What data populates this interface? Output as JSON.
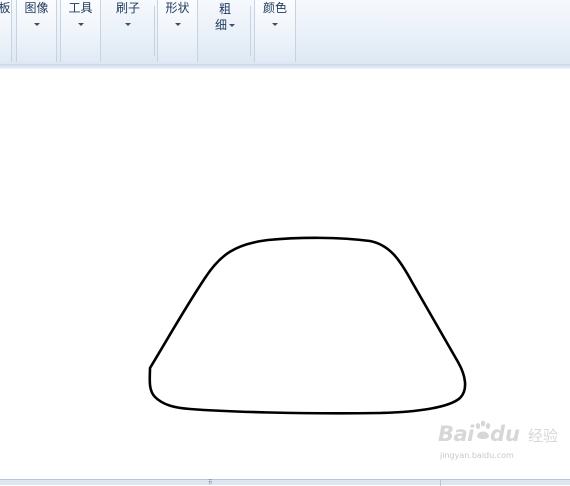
{
  "ribbon": {
    "groups": [
      {
        "id": "clipboard",
        "label": "板",
        "partial": true
      },
      {
        "id": "image",
        "label": "图像"
      },
      {
        "id": "tools",
        "label": "工具"
      },
      {
        "id": "brushes",
        "label": "刷子"
      },
      {
        "id": "shapes",
        "label": "形状"
      },
      {
        "id": "size",
        "label_line1": "粗",
        "label_line2": "细"
      },
      {
        "id": "colors",
        "label": "颜色"
      }
    ]
  },
  "canvas": {
    "shape": "trapezoid-outline",
    "stroke_color": "#000000",
    "background": "#ffffff"
  },
  "watermark": {
    "brand_part1": "Bai",
    "brand_part2": "du",
    "brand_cn": "经验",
    "url": "jingyan.baidu.com"
  },
  "status_bar": {
    "grip": "⠿"
  }
}
